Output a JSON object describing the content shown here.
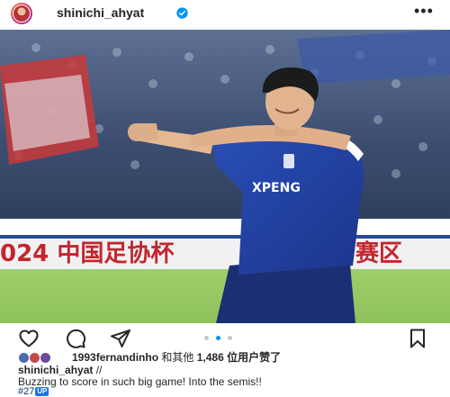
{
  "header": {
    "username": "shinichi_ahyat",
    "more_label": "•••"
  },
  "photo": {
    "banner_text": "024 中国足协杯",
    "banner_text_right": "赛区",
    "jersey_text": "XPENG"
  },
  "carousel": {
    "count": 3,
    "active_index": 1
  },
  "likes": {
    "first_liker": "1993fernandinho",
    "connector": " 和其他",
    "count_text": "1,486",
    "suffix": " 位用户赞了"
  },
  "caption": {
    "username": "shinichi_ahyat",
    "separator": " //",
    "text": "Buzzing to score in such big game! Into the semis!!",
    "hashtag": "#27",
    "hashtag_badge": "UP"
  },
  "colors": {
    "link": "#00376b",
    "verified": "#0095f6",
    "dot_active": "#0095f6",
    "dot_inactive": "#c7c7c7",
    "jersey": "#1f3f9c"
  }
}
